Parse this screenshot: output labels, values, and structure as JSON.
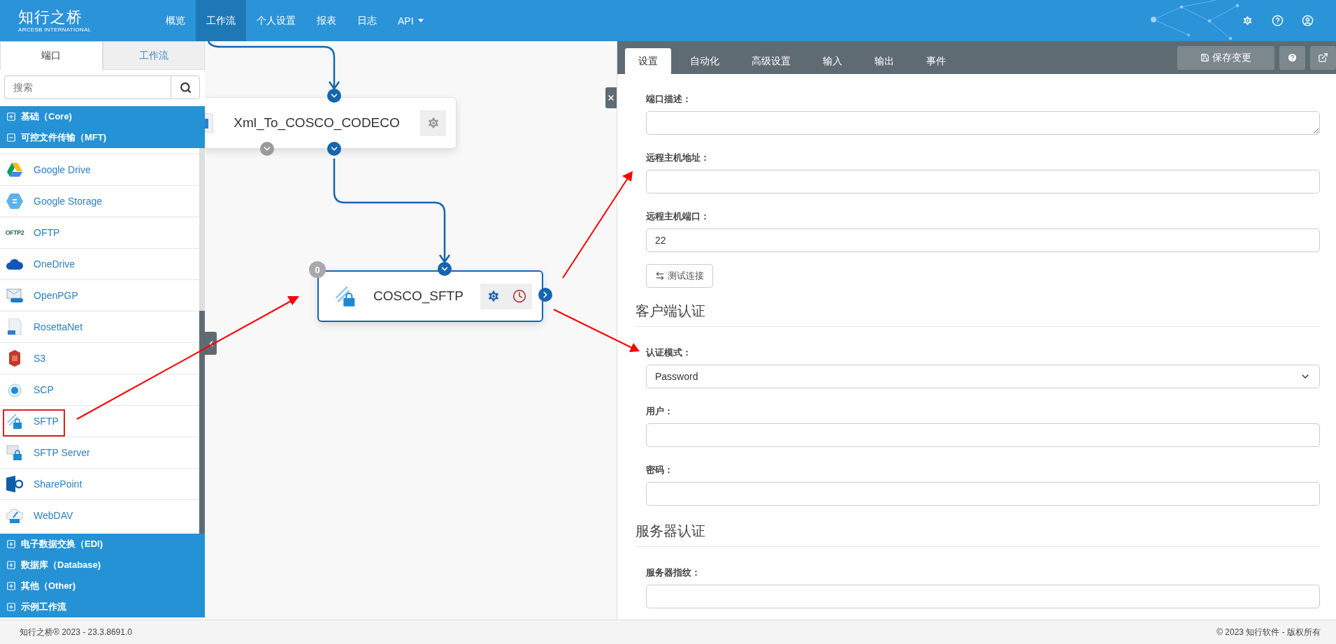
{
  "header": {
    "logo": {
      "title": "知行之桥",
      "subtitle": "ARCESB INTERNATIONAL"
    },
    "nav": [
      {
        "label": "概览",
        "selected": false
      },
      {
        "label": "工作流",
        "selected": true
      },
      {
        "label": "个人设置",
        "selected": false
      },
      {
        "label": "报表",
        "selected": false
      },
      {
        "label": "日志",
        "selected": false
      },
      {
        "label": "API",
        "selected": false,
        "dropdown": true
      }
    ]
  },
  "sidebar": {
    "tabs": [
      {
        "label": "端口",
        "selected": true
      },
      {
        "label": "工作流",
        "selected": false
      }
    ],
    "search": {
      "placeholder": "搜索"
    },
    "categories": [
      {
        "label": "基础（Core)",
        "expanded": false
      },
      {
        "label": "可控文件传输（MFT)",
        "expanded": true,
        "children": [
          {
            "label": "Google Drive"
          },
          {
            "label": "Google Storage"
          },
          {
            "label": "OFTP",
            "logo_text": "OFTP2"
          },
          {
            "label": "OneDrive"
          },
          {
            "label": "OpenPGP"
          },
          {
            "label": "RosettaNet"
          },
          {
            "label": "S3"
          },
          {
            "label": "SCP"
          },
          {
            "label": "SFTP"
          },
          {
            "label": "SFTP Server"
          },
          {
            "label": "SharePoint"
          },
          {
            "label": "WebDAV"
          }
        ]
      },
      {
        "label": "电子数据交换（EDI)",
        "expanded": false
      },
      {
        "label": "数据库（Database)",
        "expanded": false
      },
      {
        "label": "其他（Other)",
        "expanded": false
      },
      {
        "label": "示例工作流",
        "expanded": false
      }
    ]
  },
  "canvas": {
    "nodes": [
      {
        "kind": "transform",
        "name": "Xml_To_COSCO_CODECO",
        "selected": false
      },
      {
        "kind": "port",
        "name": "COSCO_SFTP",
        "selected": true,
        "badge": "0"
      }
    ]
  },
  "panel": {
    "tabs": [
      {
        "label": "设置",
        "selected": true
      },
      {
        "label": "自动化",
        "selected": false
      },
      {
        "label": "高级设置",
        "selected": false
      },
      {
        "label": "输入",
        "selected": false
      },
      {
        "label": "输出",
        "selected": false
      },
      {
        "label": "事件",
        "selected": false
      }
    ],
    "save_button": "保存变更",
    "form": [
      {
        "kind": "textarea",
        "label": "端口描述："
      },
      {
        "kind": "text",
        "label": "远程主机地址："
      },
      {
        "kind": "text",
        "label": "远程主机端口：",
        "value": "22"
      },
      {
        "kind": "button",
        "label": "测试连接"
      },
      {
        "kind": "heading",
        "label": "客户端认证"
      },
      {
        "kind": "select",
        "label": "认证模式：",
        "value": "Password"
      },
      {
        "kind": "text",
        "label": "用户："
      },
      {
        "kind": "text",
        "label": "密码："
      },
      {
        "kind": "heading",
        "label": "服务器认证"
      },
      {
        "kind": "text",
        "label": "服务器指纹："
      }
    ]
  },
  "footer": {
    "version": "知行之桥® 2023 - 23.3.8691.0",
    "copyright": "© 2023 知行软件 - 版权所有"
  }
}
